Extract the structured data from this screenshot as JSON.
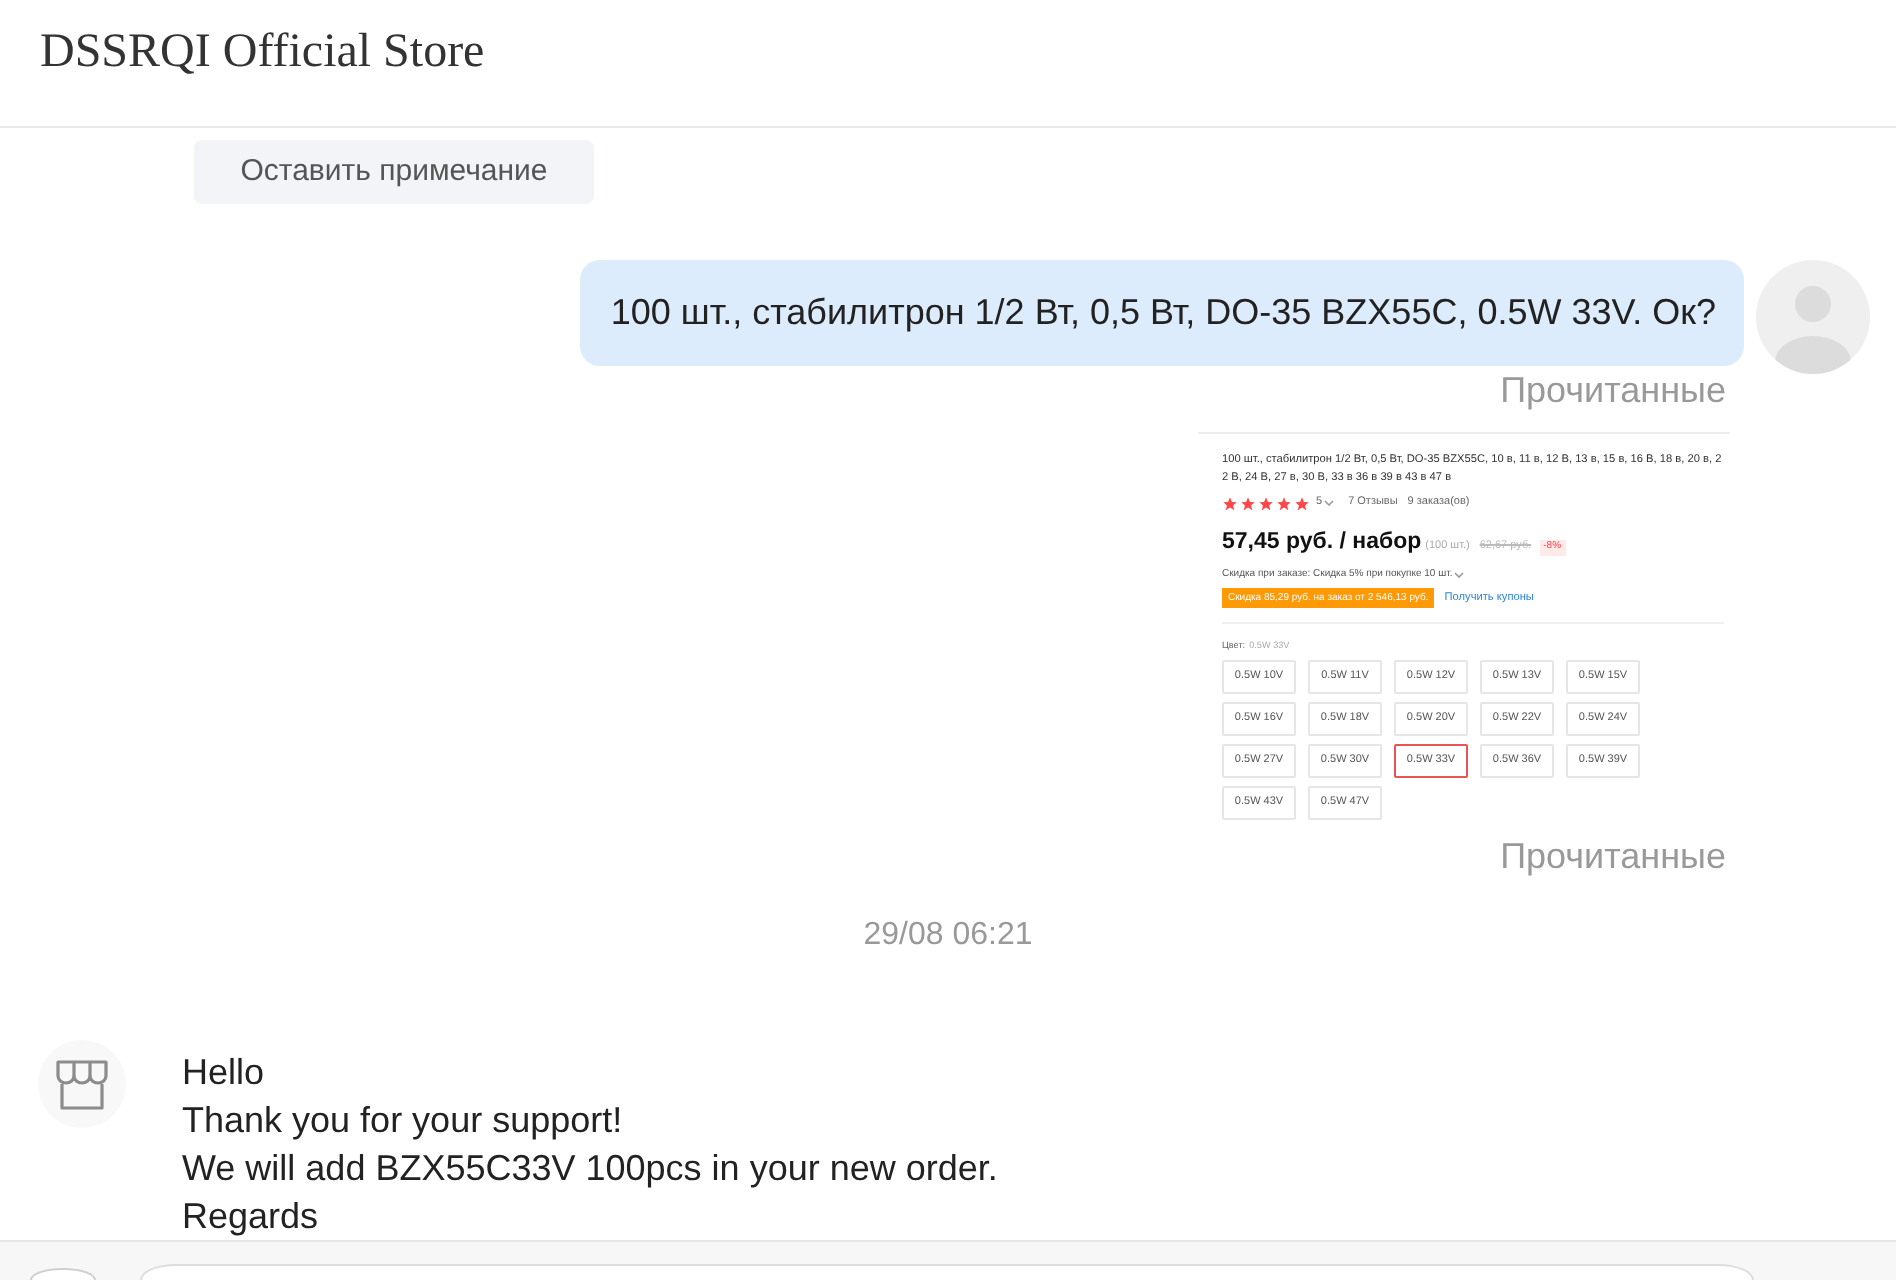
{
  "header": {
    "title": "DSSRQI Official Store"
  },
  "note_button": {
    "label": "Оставить примечание"
  },
  "messages": [
    {
      "kind": "text",
      "outgoing": true,
      "text": "100 шт., стабилитрон 1/2 Вт, 0,5 Вт, DO-35 BZX55C, 0.5W 33V. Ок?",
      "status": "Прочитанные"
    },
    {
      "kind": "product",
      "outgoing": true,
      "product": {
        "title": "100 шт., стабилитрон 1/2 Вт, 0,5 Вт, DO-35 BZX55C, 10 в, 11 в, 12 В, 13 в, 15 в, 16 В, 18 в, 20 в, 22 В, 24 В, 27 в, 30 В, 33 в 36 в 39 в 43 в 47 в",
        "stars": 5,
        "rating": "5",
        "reviews": "7 Отзывы",
        "orders": "9 заказа(ов)",
        "price": "57,45 руб. / набор",
        "unit": "(100 шт.)",
        "old_price": "62,67 руб.",
        "discount": "-8%",
        "bulk_discount": "Скидка при заказе: Скидка 5% при покупке 10 шт.",
        "coupon": "Скидка 85,29 руб. на заказ от 2 546,13 руб.",
        "coupon_link": "Получить купоны",
        "color_label": "Цвет:",
        "color_value": "0.5W 33V",
        "options": [
          {
            "label": "0.5W 10V",
            "selected": false
          },
          {
            "label": "0.5W 11V",
            "selected": false
          },
          {
            "label": "0.5W 12V",
            "selected": false
          },
          {
            "label": "0.5W 13V",
            "selected": false
          },
          {
            "label": "0.5W 15V",
            "selected": false
          },
          {
            "label": "0.5W 16V",
            "selected": false
          },
          {
            "label": "0.5W 18V",
            "selected": false
          },
          {
            "label": "0.5W 20V",
            "selected": false
          },
          {
            "label": "0.5W 22V",
            "selected": false
          },
          {
            "label": "0.5W 24V",
            "selected": false
          },
          {
            "label": "0.5W 27V",
            "selected": false
          },
          {
            "label": "0.5W 30V",
            "selected": false
          },
          {
            "label": "0.5W 33V",
            "selected": true
          },
          {
            "label": "0.5W 36V",
            "selected": false
          },
          {
            "label": "0.5W 39V",
            "selected": false
          },
          {
            "label": "0.5W 43V",
            "selected": false
          },
          {
            "label": "0.5W 47V",
            "selected": false
          }
        ]
      },
      "status": "Прочитанные"
    },
    {
      "kind": "time",
      "text": "29/08 06:21"
    },
    {
      "kind": "text",
      "outgoing": false,
      "text": "Hello\nThank you for your support!\nWe will add BZX55C33V 100pcs in your new order.\nRegards"
    }
  ]
}
